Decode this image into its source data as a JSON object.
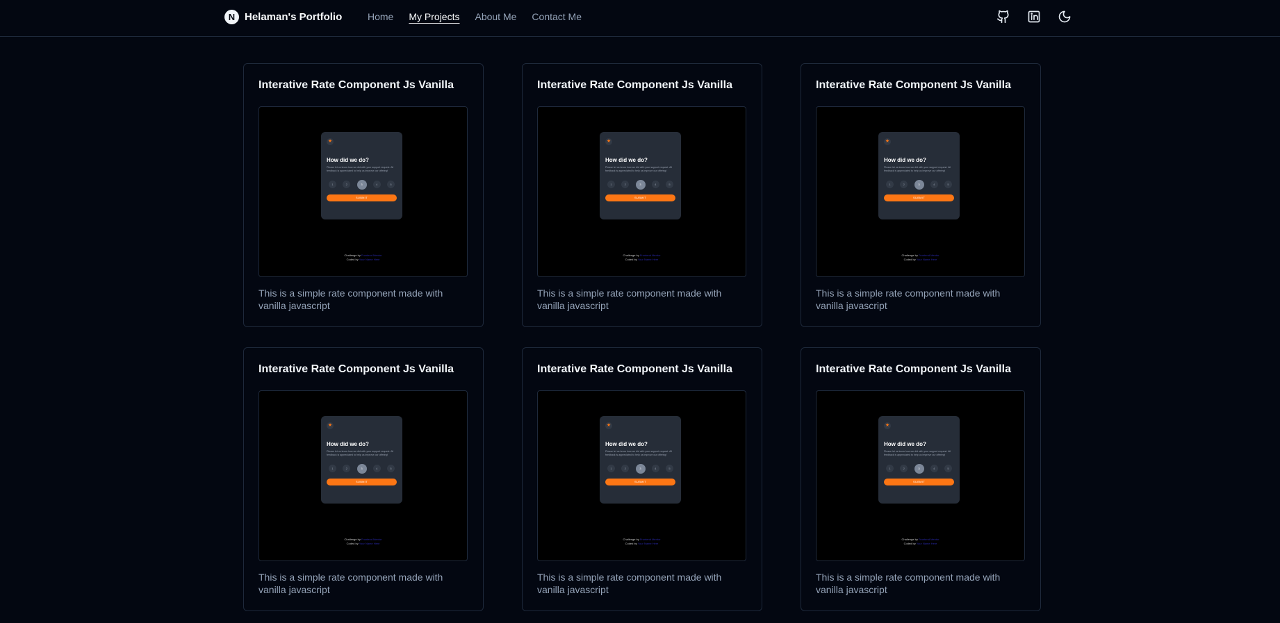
{
  "nav": {
    "brand": "Helaman's Portfolio",
    "logo_letter": "N",
    "links": [
      {
        "label": "Home",
        "active": false
      },
      {
        "label": "My Projects",
        "active": true
      },
      {
        "label": "About Me",
        "active": false
      },
      {
        "label": "Contact Me",
        "active": false
      }
    ],
    "icons": [
      "github-icon",
      "linkedin-icon",
      "moon-icon"
    ]
  },
  "projects": [
    {
      "title": "Interative Rate Component Js Vanilla",
      "description": "This is a simple rate component made with vanilla javascript",
      "preview": {
        "heading": "How did we do?",
        "text": "Please let us know how we did with your support request. All feedback is appreciated to help us improve our offering!",
        "numbers": [
          "1",
          "2",
          "3",
          "4",
          "5"
        ],
        "selected": "3",
        "submit": "SUBMIT",
        "challenge_by": "Challenge by",
        "challenge_link": "Frontend Mentor",
        "coded_by": "Coded by",
        "coded_link": "Your Name Here"
      }
    },
    {
      "title": "Interative Rate Component Js Vanilla",
      "description": "This is a simple rate component made with vanilla javascript",
      "preview": {
        "heading": "How did we do?",
        "text": "Please let us know how we did with your support request. All feedback is appreciated to help us improve our offering!",
        "numbers": [
          "1",
          "2",
          "3",
          "4",
          "5"
        ],
        "selected": "3",
        "submit": "SUBMIT",
        "challenge_by": "Challenge by",
        "challenge_link": "Frontend Mentor",
        "coded_by": "Coded by",
        "coded_link": "Your Name Here"
      }
    },
    {
      "title": "Interative Rate Component Js Vanilla",
      "description": "This is a simple rate component made with vanilla javascript",
      "preview": {
        "heading": "How did we do?",
        "text": "Please let us know how we did with your support request. All feedback is appreciated to help us improve our offering!",
        "numbers": [
          "1",
          "2",
          "3",
          "4",
          "5"
        ],
        "selected": "3",
        "submit": "SUBMIT",
        "challenge_by": "Challenge by",
        "challenge_link": "Frontend Mentor",
        "coded_by": "Coded by",
        "coded_link": "Your Name Here"
      }
    },
    {
      "title": "Interative Rate Component Js Vanilla",
      "description": "This is a simple rate component made with vanilla javascript",
      "preview": {
        "heading": "How did we do?",
        "text": "Please let us know how we did with your support request. All feedback is appreciated to help us improve our offering!",
        "numbers": [
          "1",
          "2",
          "3",
          "4",
          "5"
        ],
        "selected": "3",
        "submit": "SUBMIT",
        "challenge_by": "Challenge by",
        "challenge_link": "Frontend Mentor",
        "coded_by": "Coded by",
        "coded_link": "Your Name Here"
      }
    },
    {
      "title": "Interative Rate Component Js Vanilla",
      "description": "This is a simple rate component made with vanilla javascript",
      "preview": {
        "heading": "How did we do?",
        "text": "Please let us know how we did with your support request. All feedback is appreciated to help us improve our offering!",
        "numbers": [
          "1",
          "2",
          "3",
          "4",
          "5"
        ],
        "selected": "3",
        "submit": "SUBMIT",
        "challenge_by": "Challenge by",
        "challenge_link": "Frontend Mentor",
        "coded_by": "Coded by",
        "coded_link": "Your Name Here"
      }
    },
    {
      "title": "Interative Rate Component Js Vanilla",
      "description": "This is a simple rate component made with vanilla javascript",
      "preview": {
        "heading": "How did we do?",
        "text": "Please let us know how we did with your support request. All feedback is appreciated to help us improve our offering!",
        "numbers": [
          "1",
          "2",
          "3",
          "4",
          "5"
        ],
        "selected": "3",
        "submit": "SUBMIT",
        "challenge_by": "Challenge by",
        "challenge_link": "Frontend Mentor",
        "coded_by": "Coded by",
        "coded_link": "Your Name Here"
      }
    }
  ],
  "colors": {
    "background": "#030711",
    "border": "#1e293b",
    "muted_text": "#94a3b8",
    "accent_orange": "#fc7614"
  }
}
